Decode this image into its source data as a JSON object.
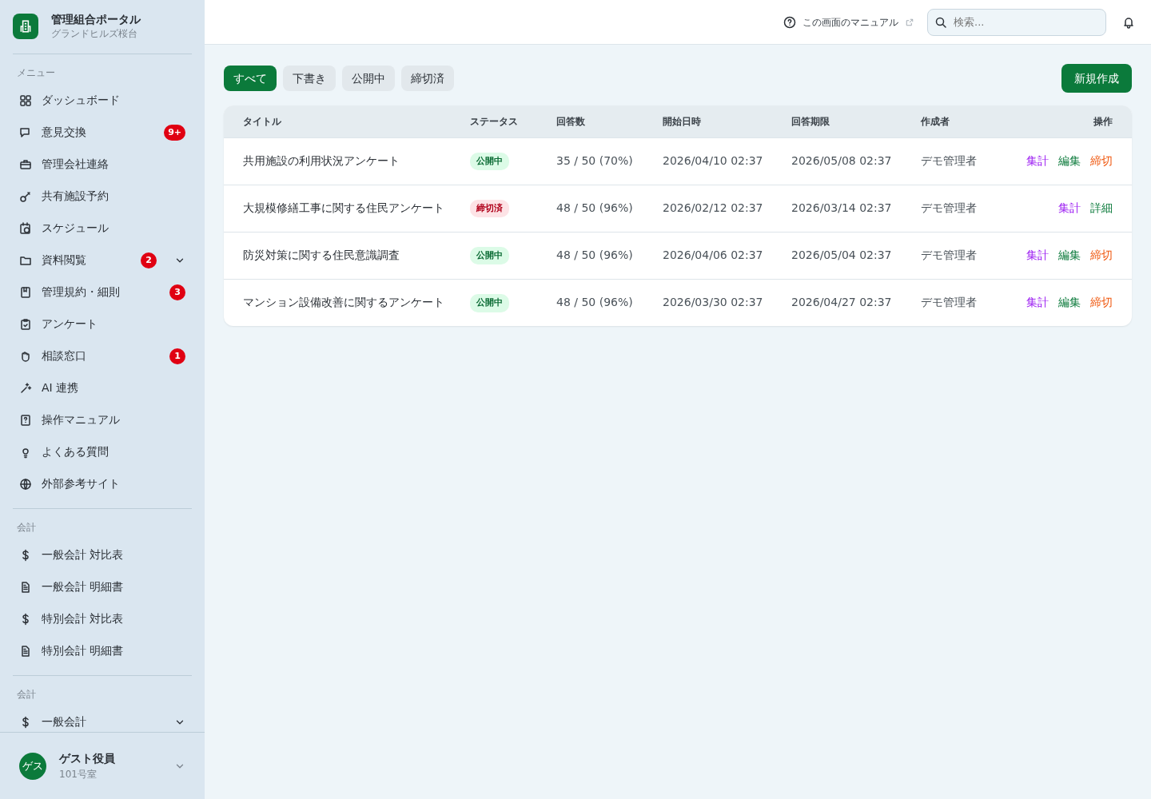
{
  "sidebar": {
    "logo_title": "管理組合ポータル",
    "logo_subtitle": "グランドヒルズ桜台",
    "sections": [
      {
        "heading": "メニュー",
        "items": [
          {
            "label": "ダッシュボード"
          },
          {
            "label": "意見交換",
            "badge": "9+"
          },
          {
            "label": "管理会社連絡"
          },
          {
            "label": "共有施設予約"
          },
          {
            "label": "スケジュール"
          },
          {
            "label": "資料閲覧",
            "badge": "2",
            "expanded": false
          },
          {
            "label": "管理規約・細則",
            "badge": "3"
          },
          {
            "label": "アンケート"
          },
          {
            "label": "相談窓口",
            "badge": "1"
          },
          {
            "label": "AI 連携"
          },
          {
            "label": "操作マニュアル"
          },
          {
            "label": "よくある質問"
          },
          {
            "label": "外部参考サイト"
          }
        ]
      },
      {
        "heading": "会計",
        "items": [
          {
            "label": "一般会計 対比表"
          },
          {
            "label": "一般会計 明細書"
          },
          {
            "label": "特別会計 対比表"
          },
          {
            "label": "特別会計 明細書"
          }
        ]
      },
      {
        "heading": "会計",
        "items": [
          {
            "label": "一般会計",
            "expanded": false
          }
        ]
      }
    ],
    "user": {
      "avatar": "ゲス",
      "name": "ゲスト役員",
      "room": "101号室",
      "expanded": false
    }
  },
  "header": {
    "manual_link": "この画面のマニュアル",
    "search": {
      "placeholder": "検索..."
    }
  },
  "filter_tabs": [
    {
      "label": "すべて",
      "selected": true
    },
    {
      "label": "下書き",
      "selected": false
    },
    {
      "label": "公開中",
      "selected": false
    },
    {
      "label": "締切済",
      "selected": false
    }
  ],
  "new_button": "新規作成",
  "table": {
    "columns": [
      "タイトル",
      "ステータス",
      "回答数",
      "開始日時",
      "回答期限",
      "作成者",
      "操作"
    ],
    "rows": [
      {
        "title": "共用施設の利用状況アンケート",
        "status": {
          "label": "公開中",
          "kind": "open"
        },
        "responses": "35 / 50 (70%)",
        "start": "2026/04/10 02:37",
        "deadline": "2026/05/08 02:37",
        "author": "デモ管理者",
        "actions": [
          {
            "label": "集計",
            "kind": "aggregate"
          },
          {
            "label": "編集",
            "kind": "edit"
          },
          {
            "label": "締切",
            "kind": "close"
          }
        ]
      },
      {
        "title": "大規模修繕工事に関する住民アンケート",
        "status": {
          "label": "締切済",
          "kind": "closed"
        },
        "responses": "48 / 50 (96%)",
        "start": "2026/02/12 02:37",
        "deadline": "2026/03/14 02:37",
        "author": "デモ管理者",
        "actions": [
          {
            "label": "集計",
            "kind": "aggregate"
          },
          {
            "label": "詳細",
            "kind": "detail"
          }
        ]
      },
      {
        "title": "防災対策に関する住民意識調査",
        "status": {
          "label": "公開中",
          "kind": "open"
        },
        "responses": "48 / 50 (96%)",
        "start": "2026/04/06 02:37",
        "deadline": "2026/05/04 02:37",
        "author": "デモ管理者",
        "actions": [
          {
            "label": "集計",
            "kind": "aggregate"
          },
          {
            "label": "編集",
            "kind": "edit"
          },
          {
            "label": "締切",
            "kind": "close"
          }
        ]
      },
      {
        "title": "マンション設備改善に関するアンケート",
        "status": {
          "label": "公開中",
          "kind": "open"
        },
        "responses": "48 / 50 (96%)",
        "start": "2026/03/30 02:37",
        "deadline": "2026/04/27 02:37",
        "author": "デモ管理者",
        "actions": [
          {
            "label": "集計",
            "kind": "aggregate"
          },
          {
            "label": "編集",
            "kind": "edit"
          },
          {
            "label": "締切",
            "kind": "close"
          }
        ]
      }
    ]
  }
}
